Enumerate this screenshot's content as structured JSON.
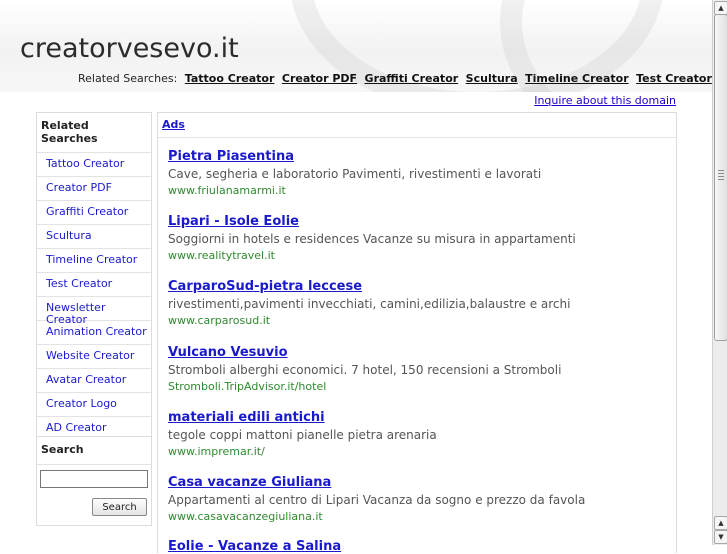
{
  "header": {
    "site_title": "creatorvesevo.it",
    "related_prefix": "Related Searches:",
    "related_links": [
      "Tattoo Creator",
      "Creator PDF",
      "Graffiti Creator",
      "Scultura",
      "Timeline Creator",
      "Test Creator"
    ]
  },
  "inquire_link": "Inquire about this domain",
  "sidebar": {
    "title": "Related Searches",
    "items": [
      "Tattoo Creator",
      "Creator PDF",
      "Graffiti Creator",
      "Scultura",
      "Timeline Creator",
      "Test Creator",
      "Newsletter Creator",
      "Animation Creator",
      "Website Creator",
      "Avatar Creator",
      "Creator Logo",
      "AD Creator"
    ]
  },
  "search": {
    "title": "Search",
    "input_value": "",
    "button_label": "Search"
  },
  "main": {
    "ads_label": "Ads",
    "ads": [
      {
        "title": "Pietra Piasentina",
        "desc": "Cave, segheria e laboratorio Pavimenti, rivestimenti e lavorati",
        "url": "www.friulanamarmi.it"
      },
      {
        "title": "Lipari - Isole Eolie",
        "desc": "Soggiorni in hotels e residences Vacanze su misura in appartamenti",
        "url": "www.realitytravel.it"
      },
      {
        "title": "CarparoSud-pietra leccese",
        "desc": "rivestimenti,pavimenti invecchiati, camini,edilizia,balaustre e archi",
        "url": "www.carparosud.it"
      },
      {
        "title": "Vulcano Vesuvio",
        "desc": "Stromboli alberghi economici. 7 hotel, 150 recensioni a Stromboli",
        "url": "Stromboli.TripAdvisor.it/hotel"
      },
      {
        "title": "materiali edili antichi",
        "desc": "tegole coppi mattoni pianelle pietra arenaria",
        "url": "www.impremar.it/"
      },
      {
        "title": "Casa vacanze Giuliana",
        "desc": "Appartamenti al centro di Lipari Vacanza da sogno e prezzo da favola",
        "url": "www.casavacanzegiuliana.it"
      },
      {
        "title": "Eolie - Vacanze a Salina",
        "desc": "",
        "url": ""
      }
    ]
  },
  "colors": {
    "link_blue": "#1a1acc",
    "url_green": "#2f8a2f",
    "border": "#dcdcdc"
  },
  "icons": {
    "scroll_up": "arrow-up-icon",
    "scroll_down": "arrow-down-icon"
  }
}
